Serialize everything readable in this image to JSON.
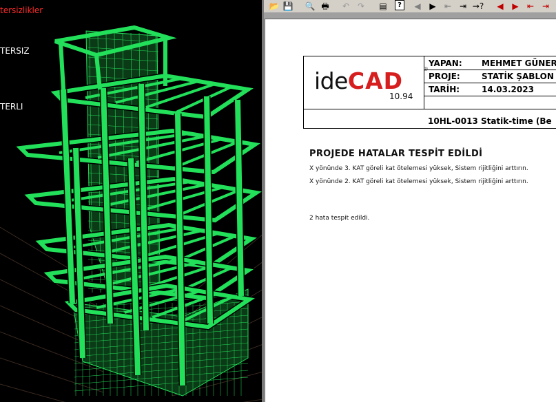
{
  "viewport": {
    "labels": [
      {
        "text": "tersizlikler",
        "color": "red"
      },
      {
        "text": "TERSIZ",
        "color": "white"
      },
      {
        "text": "TERLI",
        "color": "white"
      }
    ],
    "model_color": "#22e05a"
  },
  "toolbar": {
    "buttons": [
      {
        "name": "open-folder-icon",
        "glyph": "📂"
      },
      {
        "name": "save-icon",
        "glyph": "💾"
      },
      {
        "name": "print-preview-icon",
        "glyph": "🔍"
      },
      {
        "name": "print-icon",
        "glyph": "🖶"
      },
      {
        "name": "undo-icon",
        "glyph": "↶"
      },
      {
        "name": "redo-icon",
        "glyph": "↷"
      },
      {
        "name": "page-icon",
        "glyph": "▤"
      },
      {
        "name": "help-icon",
        "glyph": "?"
      },
      {
        "name": "back-arrow-icon",
        "glyph": "◀"
      },
      {
        "name": "forward-arrow-icon",
        "glyph": "▶"
      },
      {
        "name": "first-arrow-icon",
        "glyph": "⇤"
      },
      {
        "name": "last-arrow-icon",
        "glyph": "⇥"
      },
      {
        "name": "jump-help-icon",
        "glyph": "→?"
      },
      {
        "name": "red-left-arrow-icon",
        "glyph": "◀"
      },
      {
        "name": "red-right-arrow-icon",
        "glyph": "▶"
      },
      {
        "name": "red-first-icon",
        "glyph": "⇤"
      },
      {
        "name": "red-last-icon",
        "glyph": "⇥"
      }
    ]
  },
  "report": {
    "logo_ide": "ide",
    "logo_cad": "CAD",
    "logo_reg": "®",
    "version": "10.94",
    "fields": [
      {
        "key": "YAPAN:",
        "value": "MEHMET GÜNER"
      },
      {
        "key": "PROJE:",
        "value": "STATİK ŞABLON"
      },
      {
        "key": "TARİH:",
        "value": "14.03.2023"
      }
    ],
    "reference": "10HL-0013 Statik-time (Be",
    "error_title": "PROJEDE HATALAR TESPİT EDİLDİ",
    "errors": [
      "X yönünde 3. KAT göreli kat ötelemesi yüksek, Sistem rijitliğini arttırın.",
      "X yönünde 2. KAT göreli kat ötelemesi yüksek, Sistem rijitliğini arttırın."
    ],
    "summary": "2 hata tespit edildi."
  }
}
